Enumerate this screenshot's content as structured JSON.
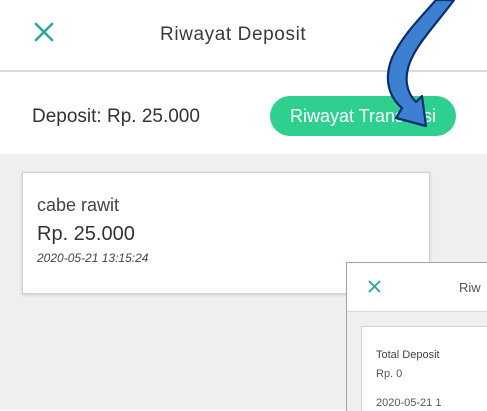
{
  "header": {
    "title": "Riwayat Deposit",
    "close_icon": "close-icon"
  },
  "summary": {
    "deposit_label": "Deposit: Rp. 25.000",
    "history_button_label": "Riwayat Transaksi"
  },
  "deposit_list": [
    {
      "name": "cabe rawit",
      "amount": "Rp. 25.000",
      "time": "2020-05-21 13:15:24"
    }
  ],
  "popup": {
    "title": "Riw",
    "card": {
      "label": "Total Deposit",
      "amount": "Rp. 0",
      "time": "2020-05-21 1"
    }
  },
  "colors": {
    "accent": "#2fd08f",
    "arrow": "#3d7fd0",
    "background_list": "#efefef"
  },
  "annotation": {
    "icon": "curved-arrow-icon"
  }
}
